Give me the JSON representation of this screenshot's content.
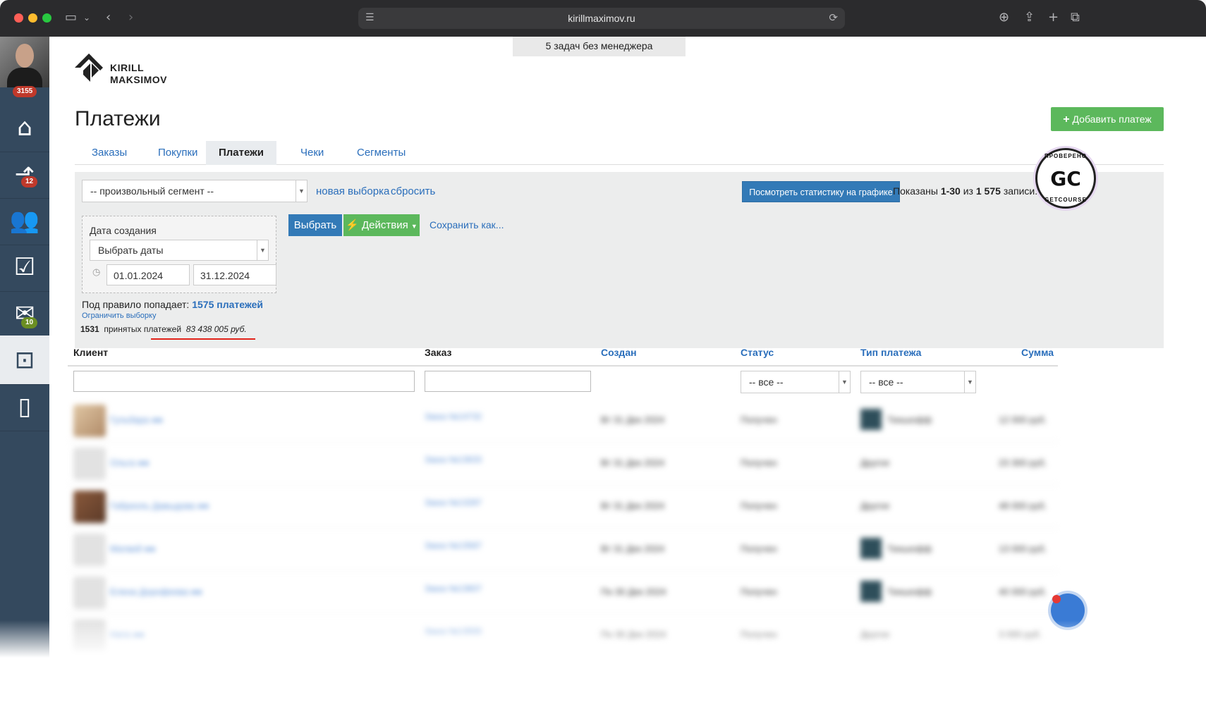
{
  "browser": {
    "url": "kirillmaximov.ru"
  },
  "sidebar": {
    "avatar_badge": "3155",
    "items": [
      {
        "name": "home",
        "badge": ""
      },
      {
        "name": "stats",
        "badge": "12"
      },
      {
        "name": "users",
        "badge": ""
      },
      {
        "name": "tasks",
        "badge": ""
      },
      {
        "name": "mail",
        "badge": "10"
      },
      {
        "name": "sales",
        "badge": ""
      },
      {
        "name": "mobile",
        "badge": ""
      }
    ]
  },
  "top_notice": "5 задач без менеджера",
  "logo": {
    "line1": "KIRILL",
    "line2": "MAKSIMOV"
  },
  "page_title": "Платежи",
  "add_button": "Добавить платеж",
  "tabs": [
    {
      "label": "Заказы",
      "active": false
    },
    {
      "label": "Покупки",
      "active": false
    },
    {
      "label": "Платежи",
      "active": true
    },
    {
      "label": "Чеки",
      "active": false
    },
    {
      "label": "Сегменты",
      "active": false
    }
  ],
  "filters": {
    "segment_select": "-- произвольный сегмент --",
    "new_selection": "новая выборка",
    "reset": "сбросить",
    "stats_button": "Посмотреть статистику на графике",
    "shown_prefix": "Показаны",
    "shown_range": "1-30",
    "shown_of": "из",
    "shown_total": "1 575",
    "shown_suffix": "записи.",
    "date_label": "Дата создания",
    "date_select": "Выбрать даты",
    "date_from": "01.01.2024",
    "date_to": "31.12.2024",
    "choose_button": "Выбрать",
    "actions_button": "Действия",
    "save_as": "Сохранить как...",
    "rule_prefix": "Под правило попадает:",
    "rule_count": "1575 платежей",
    "limit_link": "Ограничить выборку"
  },
  "seal": {
    "top": "ПРОВЕРЕНО",
    "center": "GC",
    "bottom": "GETCOURSE"
  },
  "summary": {
    "count": "1531",
    "label": "принятых платежей",
    "amount": "83 438 005 руб."
  },
  "table": {
    "headers": {
      "client": "Клиент",
      "order": "Заказ",
      "created": "Создан",
      "status": "Статус",
      "ptype": "Тип платежа",
      "sum": "Сумма"
    },
    "status_filter": "-- все --",
    "ptype_filter": "-- все --",
    "rows": [
      {
        "avatar": "photo1",
        "name": "Гульбара ●●",
        "order": "Заказ №14732",
        "created": "Вт 31 Дек 2024",
        "status": "Получен",
        "ptype": "Тинькофф",
        "ptype_icon": true,
        "sum": "12 000 руб."
      },
      {
        "avatar": "ghost",
        "name": "Ольга ●●",
        "order": "Заказ №13633",
        "created": "Вт 31 Дек 2024",
        "status": "Получен",
        "ptype": "Другое",
        "ptype_icon": false,
        "sum": "23 300 руб."
      },
      {
        "avatar": "photo2",
        "name": "Габриэль Давыдова ●●",
        "order": "Заказ №13287",
        "created": "Вт 31 Дек 2024",
        "status": "Получен",
        "ptype": "Другое",
        "ptype_icon": false,
        "sum": "48 000 руб."
      },
      {
        "avatar": "ghost",
        "name": "Матвей ●●",
        "order": "Заказ №13587",
        "created": "Вт 31 Дек 2024",
        "status": "Получен",
        "ptype": "Тинькофф",
        "ptype_icon": true,
        "sum": "13 000 руб."
      },
      {
        "avatar": "ghost",
        "name": "Елена Дорофеева ●●",
        "order": "Заказ №13607",
        "created": "Пн 30 Дек 2024",
        "status": "Получен",
        "ptype": "Тинькофф",
        "ptype_icon": true,
        "sum": "40 000 руб."
      },
      {
        "avatar": "ghost",
        "name": "Ната ●●",
        "order": "Заказ №13555",
        "created": "Пн 30 Дек 2024",
        "status": "Получен",
        "ptype": "Другое",
        "ptype_icon": false,
        "sum": "3 000 руб."
      }
    ]
  }
}
